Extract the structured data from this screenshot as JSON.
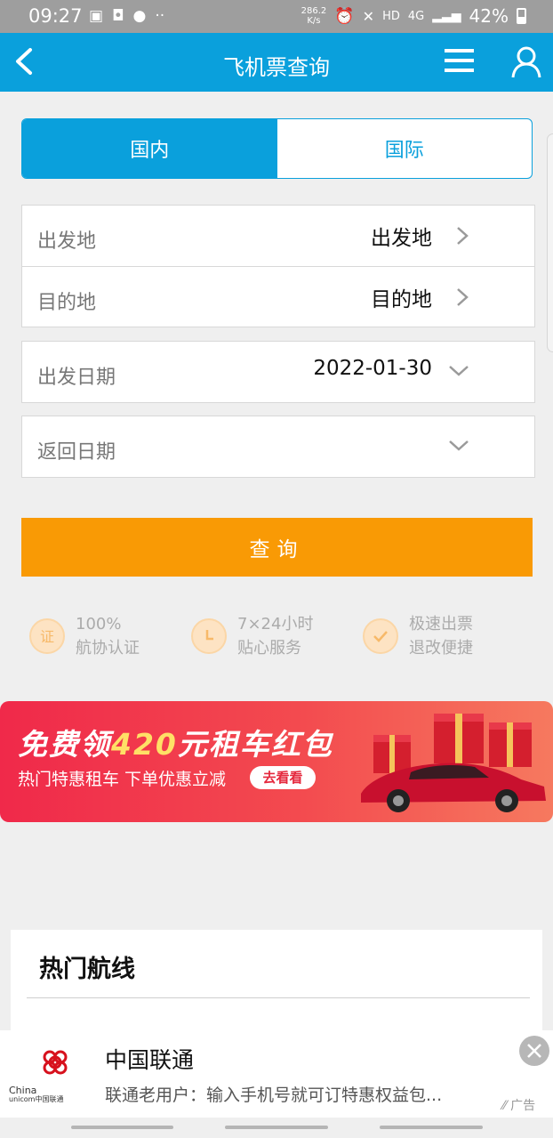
{
  "status_bar": {
    "time": "09:27",
    "speed_value": "286.2",
    "speed_unit": "K/s",
    "network_hd": "HD",
    "network_4g": "4G",
    "battery": "42%"
  },
  "header": {
    "title": "飞机票查询"
  },
  "tabs": [
    {
      "label": "国内",
      "active": true
    },
    {
      "label": "国际",
      "active": false
    }
  ],
  "form": {
    "from_label": "出发地",
    "from_value": "出发地",
    "to_label": "目的地",
    "to_value": "目的地",
    "depart_label": "出发日期",
    "depart_value": "2022-01-30",
    "return_label": "返回日期",
    "return_value": ""
  },
  "query_button": "查询",
  "features": [
    {
      "icon_text": "证",
      "line1": "100%",
      "line2": "航协认证",
      "icon": "certificate-icon"
    },
    {
      "icon_text": "",
      "line1": "7×24小时",
      "line2": "贴心服务",
      "icon": "clock-icon"
    },
    {
      "icon_text": "",
      "line1": "极速出票",
      "line2": "退改便捷",
      "icon": "check-icon"
    }
  ],
  "banner": {
    "headline_pre": "免费领",
    "headline_amount": "420",
    "headline_post": "元租车红包",
    "subtitle": "热门特惠租车 下单优惠立减",
    "cta": "去看看"
  },
  "hot_routes": {
    "title": "热门航线"
  },
  "ad": {
    "logo_text_1": "China",
    "logo_text_2": "unicom中国联通",
    "name": "中国联通",
    "description": "联通老用户：输入手机号就可订特惠权益包...",
    "tag": "广告"
  },
  "colors": {
    "primary": "#0aa0dc",
    "accent": "#f99a05",
    "banner_red": "#f0294a"
  }
}
